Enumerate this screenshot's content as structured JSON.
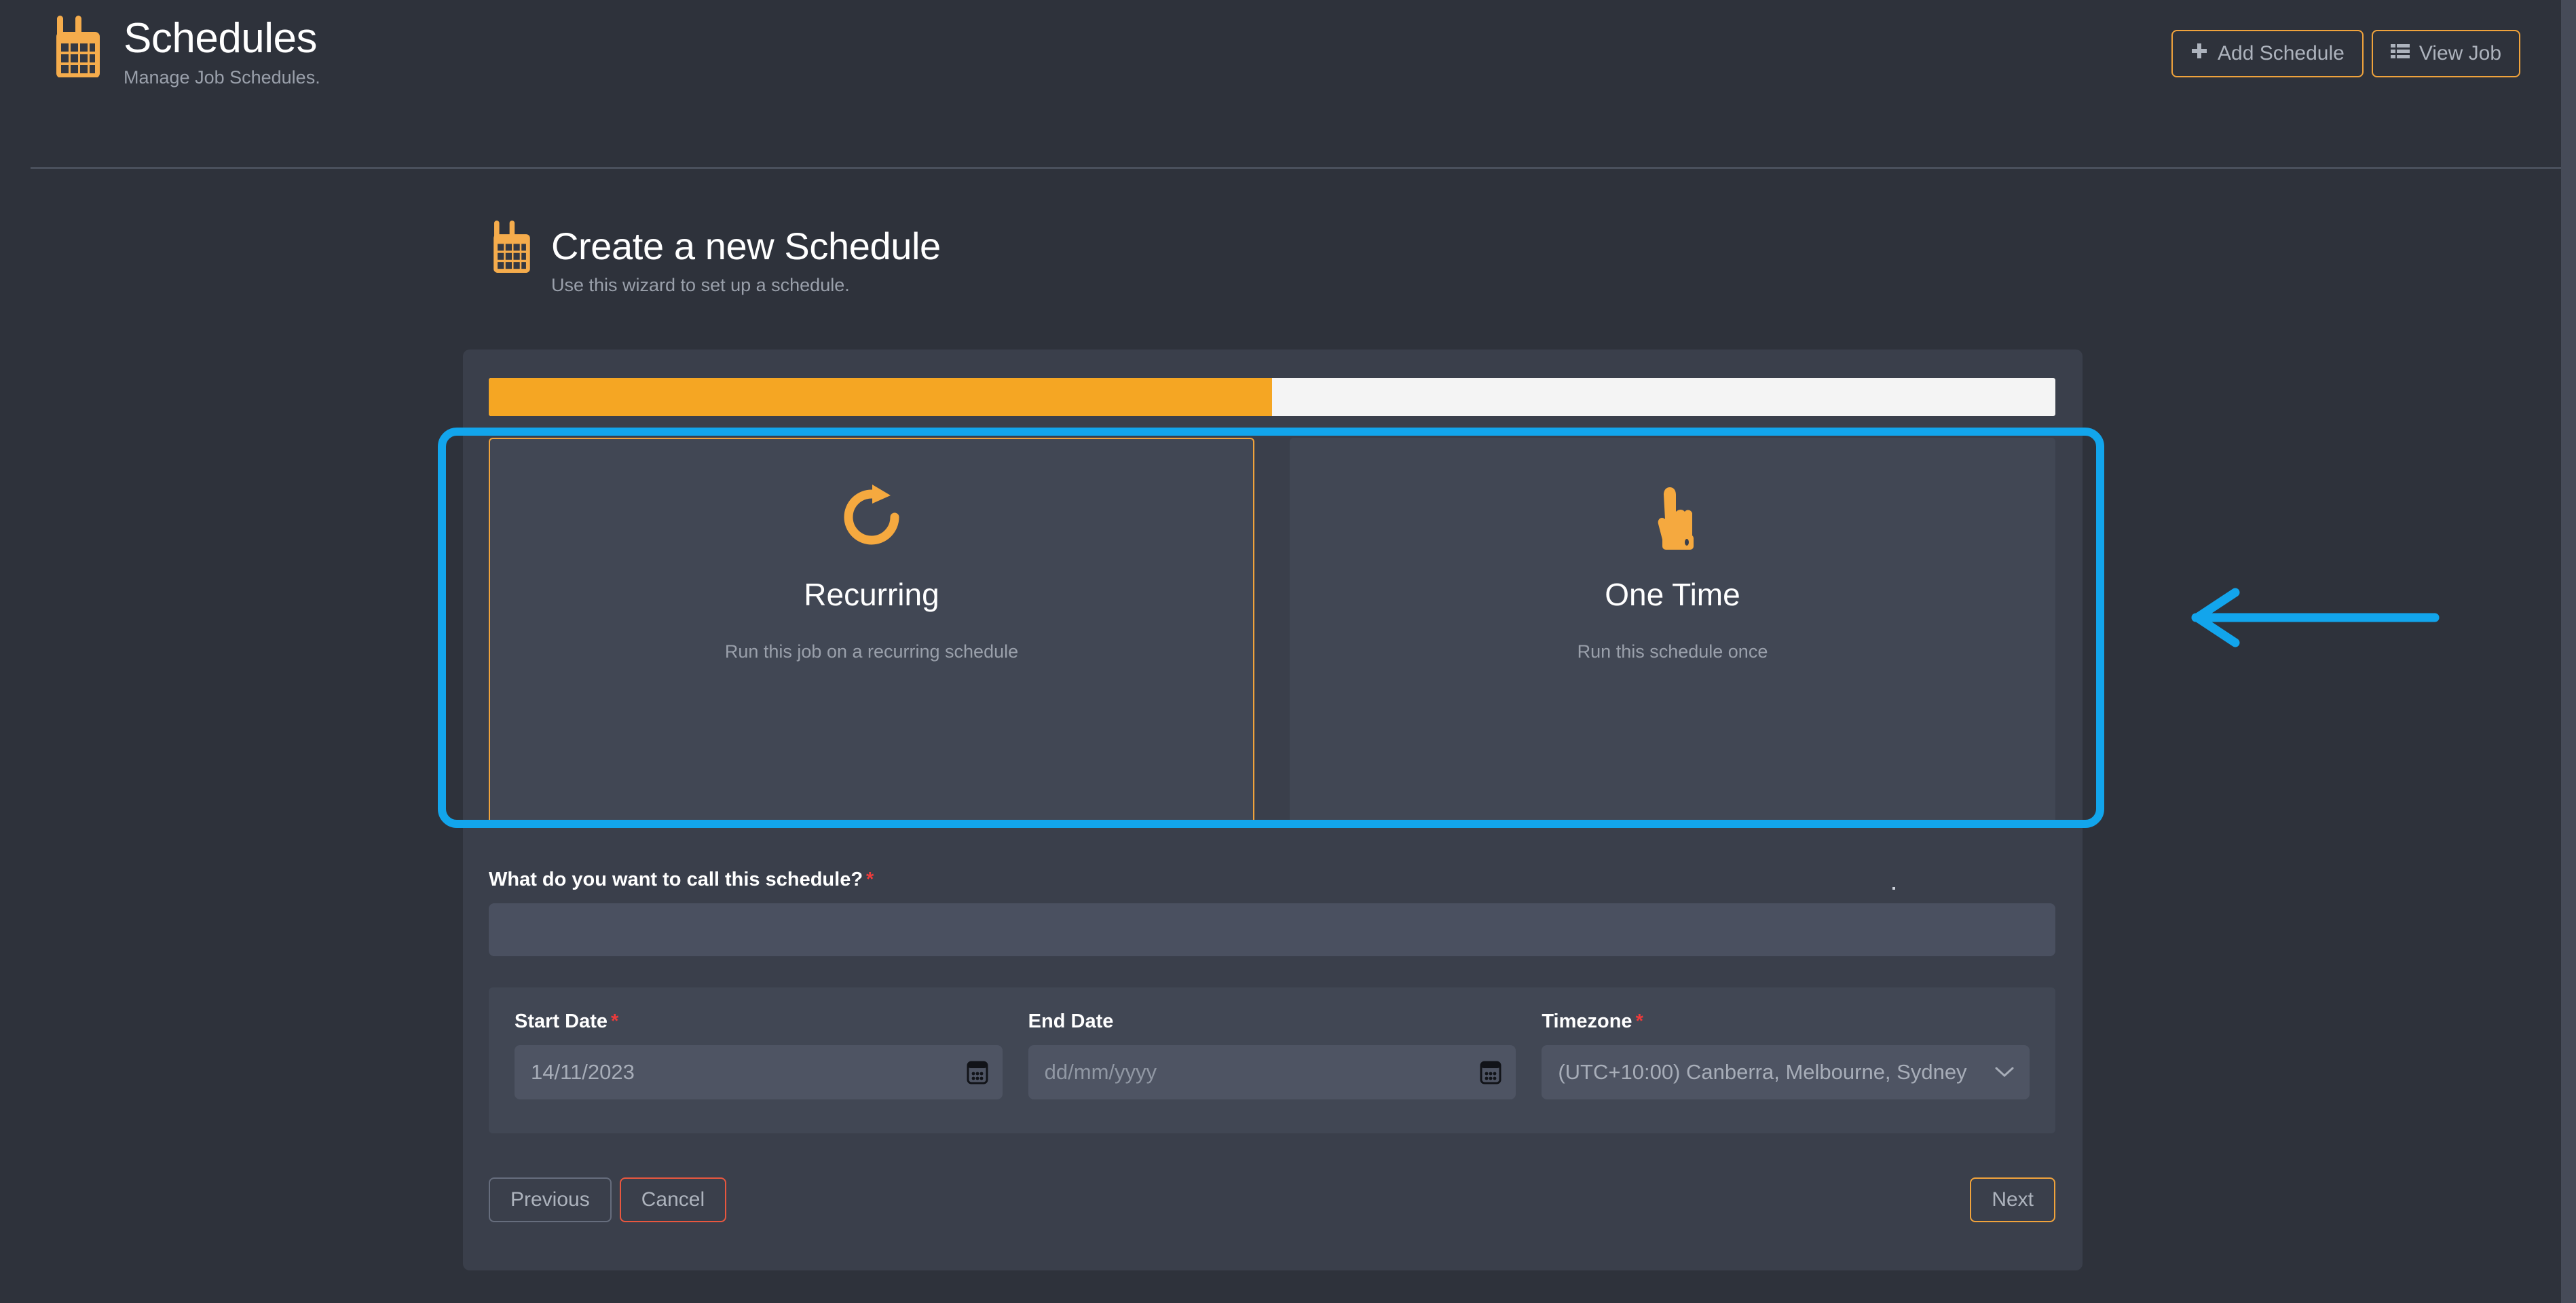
{
  "header": {
    "title": "Schedules",
    "subtitle": "Manage Job Schedules.",
    "logo_icon": "calendar-icon",
    "actions": [
      {
        "label": "Add Schedule",
        "icon": "plus-icon"
      },
      {
        "label": "View Job",
        "icon": "list-icon"
      }
    ]
  },
  "wizard": {
    "icon": "calendar-icon",
    "title": "Create a new Schedule",
    "subtitle": "Use this wizard to set up a schedule.",
    "progress_percent": 50,
    "options": [
      {
        "icon": "redo-arrow-icon",
        "title": "Recurring",
        "description": "Run this job on a recurring schedule",
        "selected": true
      },
      {
        "icon": "pointing-hand-icon",
        "title": "One Time",
        "description": "Run this schedule once",
        "selected": false
      }
    ],
    "name_field": {
      "label": "What do you want to call this schedule?",
      "required_marker": "*",
      "value": "",
      "placeholder": ""
    },
    "start_date": {
      "label": "Start Date",
      "required_marker": "*",
      "value": "14/11/2023",
      "placeholder": "dd/mm/yyyy",
      "icon": "calendar-picker-icon"
    },
    "end_date": {
      "label": "End Date",
      "required_marker": "",
      "value": "",
      "placeholder": "dd/mm/yyyy",
      "icon": "calendar-picker-icon"
    },
    "timezone": {
      "label": "Timezone",
      "required_marker": "*",
      "value": "(UTC+10:00) Canberra, Melbourne, Sydney",
      "icon": "chevron-down-icon"
    },
    "footer": {
      "previous": "Previous",
      "cancel": "Cancel",
      "next": "Next"
    }
  },
  "colors": {
    "accent_orange": "#f0a33c",
    "progress_orange": "#f5a623",
    "annotation_cyan": "#12a5ec",
    "danger_red": "#e8573f",
    "required_red": "#ee3b3b",
    "panel_bg": "#3a3f4b",
    "page_bg": "#2e323b"
  }
}
